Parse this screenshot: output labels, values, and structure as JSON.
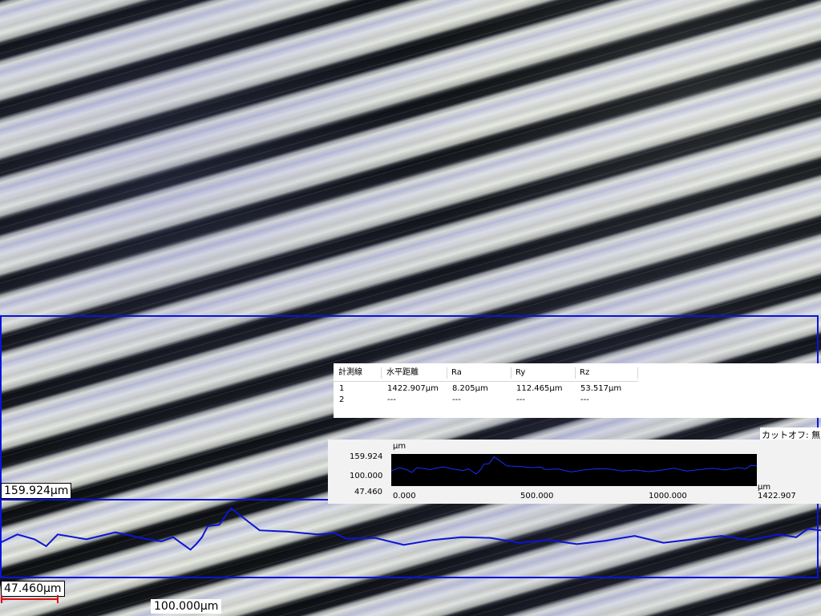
{
  "image": {
    "surface": "micrograph-texture"
  },
  "colors": {
    "profile_line": "#0a14d8",
    "scale_bar": "#e01010",
    "roi_box": "#0a14d8"
  },
  "overlay": {
    "height_top_label": "159.924µm",
    "height_bottom_label": "47.460µm",
    "scale_bar_label": "100.000µm"
  },
  "measurement_table": {
    "headers": [
      "計測線",
      "水平距離",
      "Ra",
      "Ry",
      "Rz"
    ],
    "rows": [
      [
        "1",
        "1422.907µm",
        "8.205µm",
        "112.465µm",
        "53.517µm"
      ],
      [
        "2",
        "---",
        "---",
        "---",
        "---"
      ]
    ]
  },
  "cutoff_label": "カットオフ: 無し",
  "mini_chart": {
    "y_unit": "µm",
    "x_unit": "µm",
    "y_ticks": [
      "159.924",
      "100.000",
      "47.460"
    ],
    "x_ticks": [
      "0.000",
      "500.000",
      "1000.000",
      "1422.907"
    ]
  },
  "chart_data": {
    "type": "line",
    "x_range": [
      0,
      1422.907
    ],
    "y_range": [
      47.46,
      159.924
    ],
    "series": [
      {
        "x": [
          0,
          30,
          60,
          80,
          100,
          150,
          200,
          250,
          280,
          300,
          330,
          340,
          350,
          360,
          380,
          400,
          450,
          500,
          550,
          580,
          600,
          650,
          700,
          750,
          800,
          850,
          900,
          950,
          1000,
          1050,
          1100,
          1150,
          1200,
          1250,
          1300,
          1350,
          1380,
          1400,
          1422.9
        ],
        "y": [
          100,
          112,
          105,
          95,
          112,
          105,
          115,
          106,
          102,
          108,
          90,
          98,
          108,
          124,
          126,
          150,
          118,
          116,
          112,
          114,
          106,
          107,
          97,
          104,
          108,
          107,
          100,
          104,
          98,
          103,
          110,
          100,
          105,
          110,
          104,
          112,
          108,
          120,
          118
        ]
      }
    ]
  }
}
